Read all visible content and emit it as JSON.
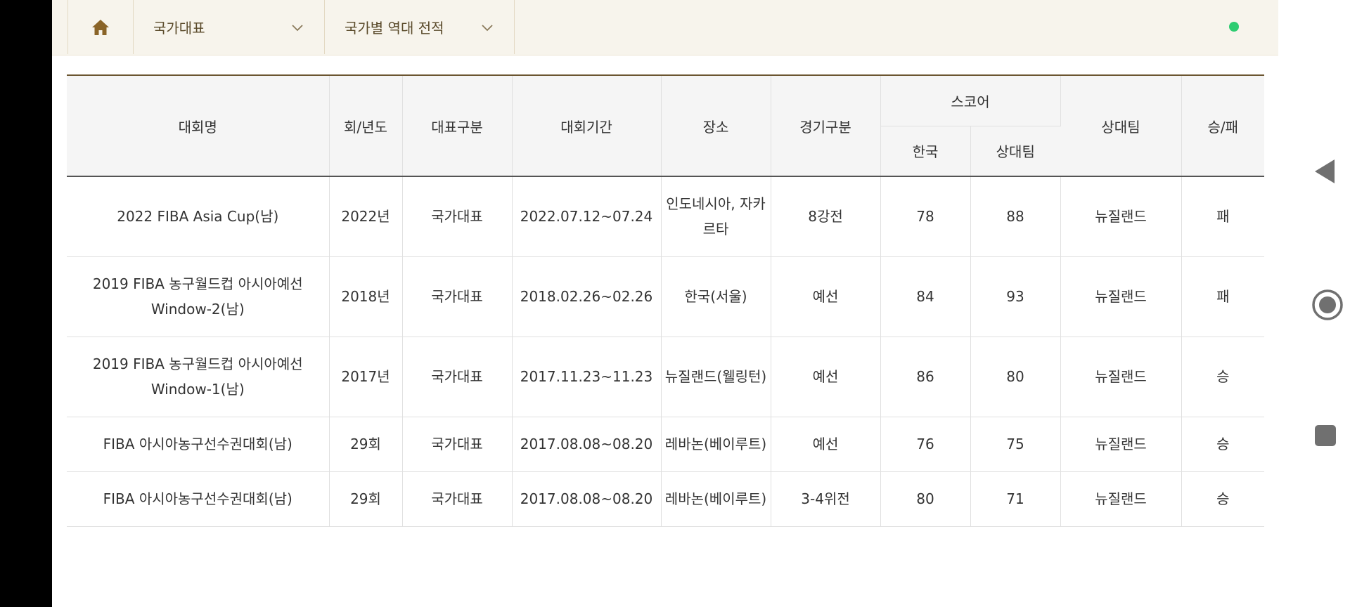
{
  "nav": {
    "home_icon": "home-icon",
    "dropdown1": "국가대표",
    "dropdown2": "국가별 역대 전적",
    "status_color": "#2ecc71"
  },
  "table": {
    "headers": {
      "tournament": "대회명",
      "round_year": "회/년도",
      "team_type": "대표구분",
      "period": "대회기간",
      "venue": "장소",
      "game_type": "경기구분",
      "score": "스코어",
      "score_korea": "한국",
      "score_opponent": "상대팀",
      "opponent": "상대팀",
      "result": "승/패"
    },
    "rows": [
      {
        "tournament": "2022 FIBA Asia Cup(남)",
        "round_year": "2022년",
        "team_type": "국가대표",
        "period": "2022.07.12~07.24",
        "venue": "인도네시아, 자카르타",
        "game_type": "8강전",
        "korea": "78",
        "opp_score": "88",
        "opponent": "뉴질랜드",
        "result": "패"
      },
      {
        "tournament": "2019 FIBA 농구월드컵 아시아예선 Window-2(남)",
        "round_year": "2018년",
        "team_type": "국가대표",
        "period": "2018.02.26~02.26",
        "venue": "한국(서울)",
        "game_type": "예선",
        "korea": "84",
        "opp_score": "93",
        "opponent": "뉴질랜드",
        "result": "패"
      },
      {
        "tournament": "2019 FIBA 농구월드컵 아시아예선 Window-1(남)",
        "round_year": "2017년",
        "team_type": "국가대표",
        "period": "2017.11.23~11.23",
        "venue": "뉴질랜드(웰링턴)",
        "game_type": "예선",
        "korea": "86",
        "opp_score": "80",
        "opponent": "뉴질랜드",
        "result": "승"
      },
      {
        "tournament": "FIBA 아시아농구선수권대회(남)",
        "round_year": "29회",
        "team_type": "국가대표",
        "period": "2017.08.08~08.20",
        "venue": "레바논(베이루트)",
        "game_type": "예선",
        "korea": "76",
        "opp_score": "75",
        "opponent": "뉴질랜드",
        "result": "승"
      },
      {
        "tournament": "FIBA 아시아농구선수권대회(남)",
        "round_year": "29회",
        "team_type": "국가대표",
        "period": "2017.08.08~08.20",
        "venue": "레바논(베이루트)",
        "game_type": "3-4위전",
        "korea": "80",
        "opp_score": "71",
        "opponent": "뉴질랜드",
        "result": "승"
      }
    ]
  },
  "system_nav": {
    "back_icon": "back-triangle-icon",
    "home_icon": "home-circle-icon",
    "recents_icon": "recents-square-icon"
  }
}
